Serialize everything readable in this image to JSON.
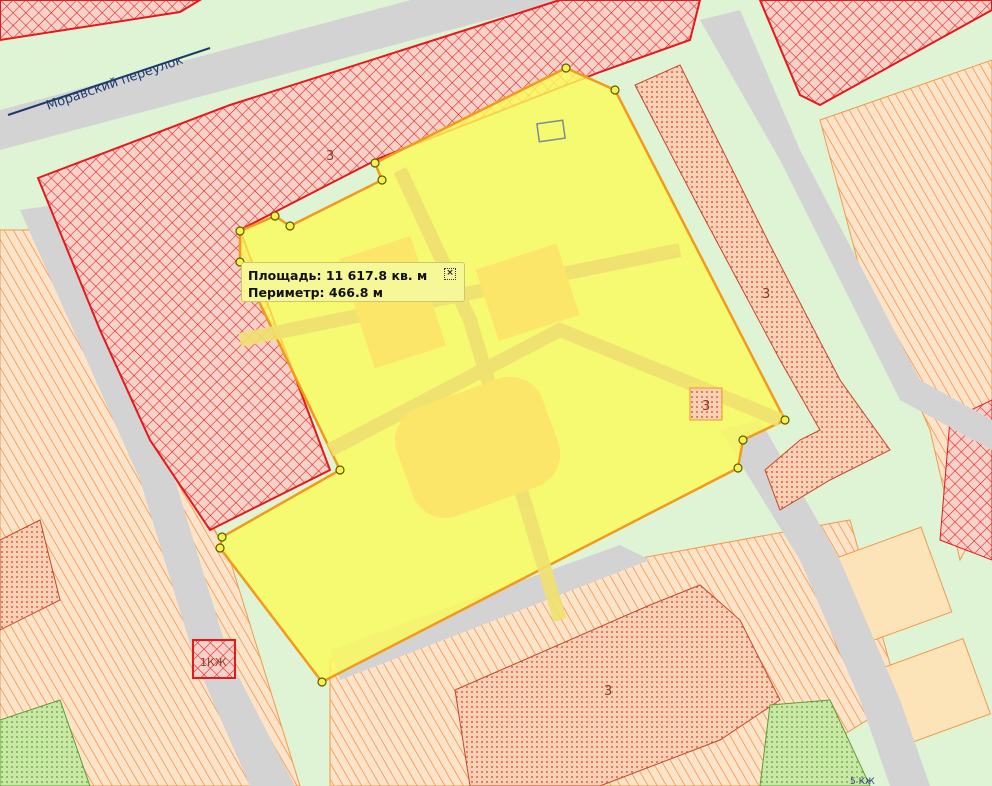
{
  "map": {
    "street_label": "Моравский переулок",
    "building_numbers": {
      "top_left": "3",
      "right": "3",
      "small_yellow": "3",
      "bottom": "3",
      "small_red": "1КЖ"
    },
    "corner_text": "5 КЖ"
  },
  "measure": {
    "area_label": "Площадь:",
    "area_value": "11 617.8 кв. м",
    "perimeter_label": "Периметр:",
    "perimeter_value": "466.8 м",
    "close_icon": "close-icon"
  },
  "colors": {
    "selection_fill": "#fbfb5a",
    "selection_outline": "#f39a1b",
    "zone_red": "#e8171c",
    "zone_orange": "#f39a4c",
    "green_area": "#dff3d5",
    "road": "#d3d3d3"
  }
}
